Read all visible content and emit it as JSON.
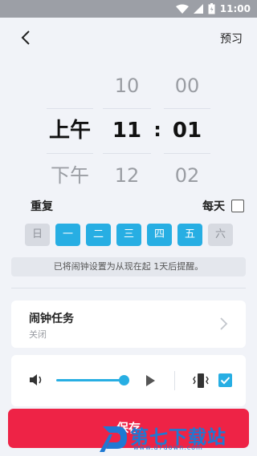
{
  "status_bar": {
    "time": "11:00",
    "icons": [
      "wifi-icon",
      "signal-icon",
      "battery-icon"
    ]
  },
  "header": {
    "back_icon": "chevron-left-icon",
    "preview_label": "预习"
  },
  "time_picker": {
    "ampm": {
      "above": "",
      "selected": "上午",
      "below": "下午"
    },
    "hour": {
      "above": "10",
      "selected": "11",
      "below": "12"
    },
    "separator": ":",
    "minute": {
      "above": "00",
      "selected": "01",
      "below": "02"
    }
  },
  "repeat": {
    "label": "重复",
    "everyday_label": "每天",
    "everyday_checked": false,
    "days": [
      {
        "label": "日",
        "selected": false
      },
      {
        "label": "一",
        "selected": true
      },
      {
        "label": "二",
        "selected": true
      },
      {
        "label": "三",
        "selected": true
      },
      {
        "label": "四",
        "selected": true
      },
      {
        "label": "五",
        "selected": true
      },
      {
        "label": "六",
        "selected": false
      }
    ]
  },
  "notice": "已将闹钟设置为从现在起 1天后提醒。",
  "task": {
    "title": "闹钟任务",
    "status": "关闭"
  },
  "sound": {
    "volume_level": 0.9,
    "vibrate_checked": true
  },
  "save_label": "保存",
  "watermark": {
    "text": "第七下载站",
    "sub": "www.d7down.com"
  },
  "colors": {
    "accent": "#27AEE3",
    "save": "#EE2346",
    "background": "#F1F3F8"
  }
}
